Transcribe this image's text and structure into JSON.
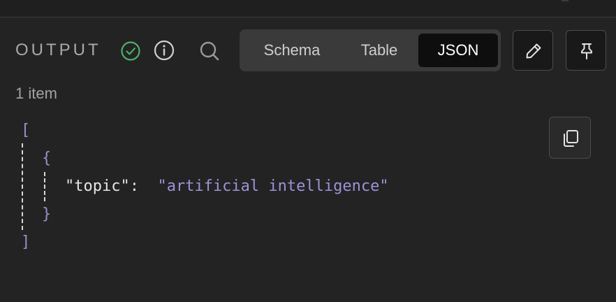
{
  "panel": {
    "title": "OUTPUT",
    "item_count": "1 item"
  },
  "icons": {
    "status": "check-circle-icon",
    "info": "info-icon",
    "search": "search-icon",
    "edit": "pencil-icon",
    "pin": "pin-icon",
    "copy": "copy-icon"
  },
  "view_tabs": {
    "schema_label": "Schema",
    "table_label": "Table",
    "json_label": "JSON",
    "selected": "JSON"
  },
  "json": {
    "open_array": "[",
    "open_object": "{",
    "key": "\"topic\":",
    "value": "\"artificial intelligence\"",
    "close_object": "}",
    "close_array": "]"
  },
  "colors": {
    "background": "#232323",
    "success": "#4caf6a",
    "json_bracket": "#9c8fcc",
    "json_string": "#9f91d6",
    "tab_active_bg": "#0e0e0e"
  }
}
